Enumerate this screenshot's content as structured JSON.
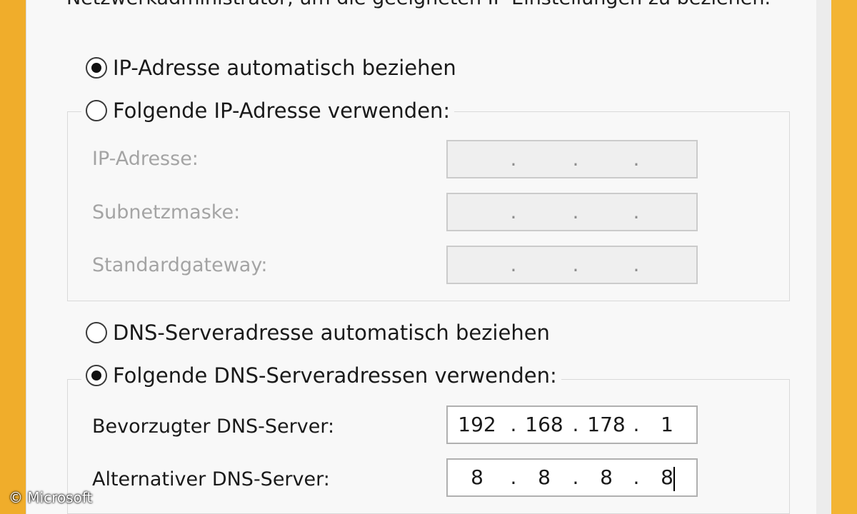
{
  "dialog": {
    "partial_intro_text": "Netzwerkadministrator, um die geeigneten IP-Einstellungen zu beziehen."
  },
  "ip": {
    "auto_label": "IP-Adresse automatisch beziehen",
    "manual_label": "Folgende IP-Adresse verwenden:",
    "selected": "auto",
    "fields": [
      {
        "label": "IP-Adresse:",
        "octets": [
          "",
          "",
          "",
          ""
        ],
        "enabled": false
      },
      {
        "label": "Subnetzmaske:",
        "octets": [
          "",
          "",
          "",
          ""
        ],
        "enabled": false
      },
      {
        "label": "Standardgateway:",
        "octets": [
          "",
          "",
          "",
          ""
        ],
        "enabled": false
      }
    ]
  },
  "dns": {
    "auto_label": "DNS-Serveradresse automatisch beziehen",
    "manual_label": "Folgende DNS-Serveradressen verwenden:",
    "selected": "manual",
    "fields": [
      {
        "label": "Bevorzugter DNS-Server:",
        "octets": [
          "192",
          "168",
          "178",
          "1"
        ],
        "enabled": true
      },
      {
        "label": "Alternativer DNS-Server:",
        "octets": [
          "8",
          "8",
          "8",
          "8"
        ],
        "enabled": true
      }
    ]
  },
  "watermark": {
    "text": "© Microsoft"
  }
}
